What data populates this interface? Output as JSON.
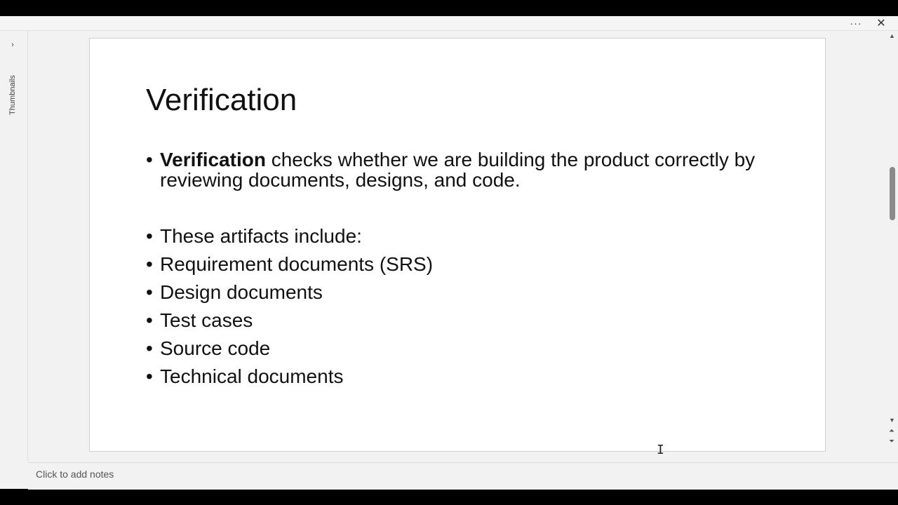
{
  "toolbar": {
    "more_icon": "more-horizontal-icon",
    "more_label": "···",
    "close_icon": "close-icon",
    "close_label": "✕"
  },
  "thumbnails": {
    "expand_label": "›",
    "label": "Thumbnails"
  },
  "slide": {
    "title": "Verification",
    "bullets": {
      "b1_bold": "Verification",
      "b1_rest": " checks whether we are building the product correctly by reviewing documents, designs, and code.",
      "b2": "These artifacts include:",
      "b3": "Requirement documents (SRS)",
      "b4": "Design documents",
      "b5": "Test cases",
      "b6": "Source code",
      "b7": "Technical documents"
    },
    "bullet_char": "•"
  },
  "scrollbar": {
    "up": "▲",
    "down": "▼",
    "prev_slide": "⏶",
    "next_slide": "⏷"
  },
  "notes": {
    "placeholder": "Click to add notes"
  },
  "colors": {
    "chrome_bg": "#f2f2f2",
    "slide_bg": "#ffffff",
    "text": "#111111",
    "scroll_thumb": "#8a8a8a"
  }
}
